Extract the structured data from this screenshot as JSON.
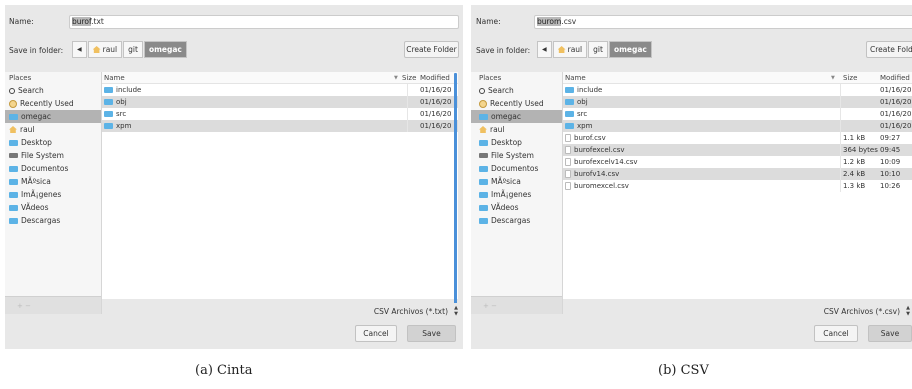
{
  "labels": {
    "name": "Name:",
    "save_in_folder": "Save in folder:",
    "places": "Places",
    "col_name": "Name",
    "col_size": "Size",
    "col_modified": "Modified"
  },
  "buttons": {
    "create_folder": "Create Folder",
    "cancel": "Cancel",
    "save": "Save"
  },
  "places": [
    "Search",
    "Recently Used",
    "omegac",
    "raul",
    "Desktop",
    "File System",
    "Documentos",
    "MÃºsica",
    "ImÃ¡genes",
    "VÃ­deos",
    "Descargas"
  ],
  "breadcrumbs": [
    "raul",
    "git",
    "omegac"
  ],
  "places_footer": "+ −",
  "dialogs": [
    {
      "name_selected": "burof",
      "name_rest": ".txt",
      "filter": "CSV Archivos (*.txt)",
      "caption": "(a) Cinta",
      "rows": [
        {
          "name": "include",
          "kind": "folder",
          "size": "",
          "modified": "01/16/20"
        },
        {
          "name": "obj",
          "kind": "folder",
          "size": "",
          "modified": "01/16/20"
        },
        {
          "name": "src",
          "kind": "folder",
          "size": "",
          "modified": "01/16/20"
        },
        {
          "name": "xpm",
          "kind": "folder",
          "size": "",
          "modified": "01/16/20"
        }
      ]
    },
    {
      "name_selected": "burom",
      "name_rest": ".csv",
      "filter": "CSV Archivos (*.csv)",
      "caption": "(b) CSV",
      "rows": [
        {
          "name": "include",
          "kind": "folder",
          "size": "",
          "modified": "01/16/20"
        },
        {
          "name": "obj",
          "kind": "folder",
          "size": "",
          "modified": "01/16/20"
        },
        {
          "name": "src",
          "kind": "folder",
          "size": "",
          "modified": "01/16/20"
        },
        {
          "name": "xpm",
          "kind": "folder",
          "size": "",
          "modified": "01/16/20"
        },
        {
          "name": "burof.csv",
          "kind": "file",
          "size": "1.1 kB",
          "modified": "09:27"
        },
        {
          "name": "burofexcel.csv",
          "kind": "file",
          "size": "364 bytes",
          "modified": "09:45"
        },
        {
          "name": "burofexcelv14.csv",
          "kind": "file",
          "size": "1.2 kB",
          "modified": "10:09"
        },
        {
          "name": "burofv14.csv",
          "kind": "file",
          "size": "2.4 kB",
          "modified": "10:10"
        },
        {
          "name": "buromexcel.csv",
          "kind": "file",
          "size": "1.3 kB",
          "modified": "10:26"
        }
      ]
    }
  ],
  "colors": {
    "selection": "#b9b9b9",
    "folder_icon": "#5cb3e6",
    "scrollbar": "#4a90d9",
    "dialog_bg": "#e8e8e8"
  },
  "icons": {
    "search": "search-icon",
    "recent": "clock-icon",
    "home": "home-icon",
    "folder": "folder-icon",
    "filesystem": "drive-icon",
    "file": "file-icon"
  }
}
